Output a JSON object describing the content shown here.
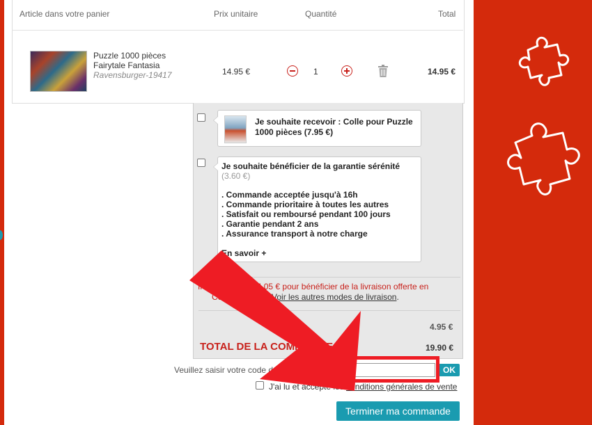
{
  "cart": {
    "headers": {
      "article": "Article dans votre panier",
      "unit_price": "Prix unitaire",
      "quantity": "Quantité",
      "total": "Total"
    },
    "item": {
      "name_line1": "Puzzle 1000 pièces",
      "name_line2": "Fairytale Fantasia",
      "ref": "Ravensburger-19417",
      "unit_price": "14.95 €",
      "quantity": "1",
      "total": "14.95 €"
    }
  },
  "options": {
    "glue": {
      "label": "Je souhaite recevoir : Colle pour Puzzle 1000 pièces (7.95 €)"
    },
    "guarantee": {
      "title": "Je souhaite bénéficier de la garantie sérénité",
      "price": "(3.60 €)",
      "bullets": [
        ". Commande acceptée jusqu'à 16h",
        ". Commande prioritaire à toutes les autres",
        ". Satisfait ou remboursé pendant 100 jours",
        ". Garantie pendant 2 ans",
        ". Assurance transport à notre charge"
      ],
      "more": "En savoir +"
    }
  },
  "shipping": {
    "notice_line1": "Il vous manque 4.05 € pour bénéficier de la livraison offerte en",
    "notice_line2_prefix": "Colissimo suivi.",
    "other_modes_link": "Voir les autres modes de livraison"
  },
  "totals": {
    "shipping_value": "4.95 €",
    "total_label": "TOTAL DE LA COMMANDE",
    "total_value": "19.90 €"
  },
  "promo": {
    "label": "Veuillez saisir votre code de réduction :",
    "input_value": "",
    "ok_label": "OK"
  },
  "terms": {
    "prefix": "J'ai lu et accepte les",
    "link": "conditions générales de vente"
  },
  "checkout": {
    "button_label": "Terminer ma commande"
  },
  "colors": {
    "brand_red": "#d42a0c",
    "accent_teal": "#1a9bb0",
    "annotation_red": "#ee1c24"
  }
}
